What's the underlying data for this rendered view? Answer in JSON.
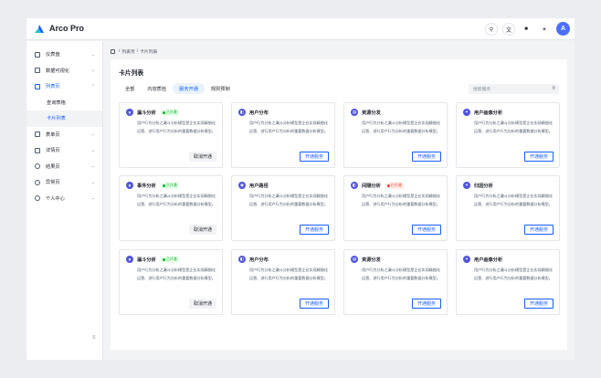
{
  "app": {
    "name": "Arco Pro"
  },
  "header": {
    "icons": [
      "search-icon",
      "language-icon",
      "notification-icon",
      "theme-icon"
    ],
    "avatar_letter": "A"
  },
  "sidebar": {
    "items": [
      {
        "label": "仪表盘",
        "icon": "dashboard-icon"
      },
      {
        "label": "数据可视化",
        "icon": "chart-icon"
      },
      {
        "label": "列表页",
        "icon": "list-icon",
        "active": true,
        "children": [
          {
            "label": "查询表格"
          },
          {
            "label": "卡片列表",
            "active": true
          }
        ]
      },
      {
        "label": "表单页",
        "icon": "form-icon"
      },
      {
        "label": "详情页",
        "icon": "file-icon"
      },
      {
        "label": "结果页",
        "icon": "check-circle-icon"
      },
      {
        "label": "异常页",
        "icon": "exclamation-icon"
      },
      {
        "label": "个人中心",
        "icon": "user-icon"
      }
    ]
  },
  "breadcrumb": {
    "items": [
      "列表页",
      "卡片列表"
    ]
  },
  "page": {
    "title": "卡片列表",
    "tabs": [
      "全部",
      "内容质检",
      "服务开通",
      "规则预制"
    ],
    "active_tab": 2,
    "search_placeholder": "搜索服务"
  },
  "cards": [
    {
      "title": "漏斗分析",
      "status": "已开通",
      "status_color": "green",
      "desc": "用户行为分析之漏斗分析模型是企业实现精细化运营、进行用户行为分析的重要数据分析模型。",
      "button": "取消开通",
      "button_style": "grey"
    },
    {
      "title": "用户分布",
      "desc": "用户行为分析之漏斗分析模型是企业实现精细化运营、进行用户行为分析的重要数据分析模型。",
      "button": "开通服务",
      "button_style": "outline"
    },
    {
      "title": "资源分发",
      "desc": "用户行为分析之漏斗分析模型是企业实现精细化运营、进行用户行为分析的重要数据分析模型。",
      "button": "开通服务",
      "button_style": "outline"
    },
    {
      "title": "用户画像分析",
      "desc": "用户行为分析之漏斗分析模型是企业实现精细化运营、进行用户行为分析的重要数据分析模型。",
      "button": "开通服务",
      "button_style": "outline"
    },
    {
      "title": "事件分析",
      "status": "已开通",
      "status_color": "green",
      "desc": "用户行为分析之漏斗分析模型是企业实现精细化运营、进行用户行为分析的重要数据分析模型。",
      "button": "取消开通",
      "button_style": "grey"
    },
    {
      "title": "用户路径",
      "desc": "用户行为分析之漏斗分析模型是企业实现精细化运营、进行用户行为分析的重要数据分析模型。",
      "button": "开通服务",
      "button_style": "outline"
    },
    {
      "title": "间隔分析",
      "status": "已开通",
      "status_color": "red",
      "desc": "用户行为分析之漏斗分析模型是企业实现精细化运营、进行用户行为分析的重要数据分析模型。",
      "button": "开通服务",
      "button_style": "outline"
    },
    {
      "title": "归因分析",
      "desc": "用户行为分析之漏斗分析模型是企业实现精细化运营、进行用户行为分析的重要数据分析模型。",
      "button": "开通服务",
      "button_style": "outline"
    },
    {
      "title": "漏斗分析",
      "status": "已开通",
      "status_color": "green",
      "desc": "用户行为分析之漏斗分析模型是企业实现精细化运营、进行用户行为分析的重要数据分析模型。",
      "button": "取消开通",
      "button_style": "grey"
    },
    {
      "title": "用户分布",
      "desc": "用户行为分析之漏斗分析模型是企业实现精细化运营、进行用户行为分析的重要数据分析模型。",
      "button": "开通服务",
      "button_style": "outline"
    },
    {
      "title": "资源分发",
      "desc": "用户行为分析之漏斗分析模型是企业实现精细化运营、进行用户行为分析的重要数据分析模型。",
      "button": "开通服务",
      "button_style": "outline"
    },
    {
      "title": "用户画像分析",
      "desc": "用户行为分析之漏斗分析模型是企业实现精细化运营、进行用户行为分析的重要数据分析模型。",
      "button": "开通服务",
      "button_style": "outline"
    }
  ],
  "colors": {
    "primary": "#165dff",
    "card_icon": "#5155d8",
    "success": "#00b42a",
    "danger": "#f53f3f",
    "avatar": "#4c6fff"
  }
}
